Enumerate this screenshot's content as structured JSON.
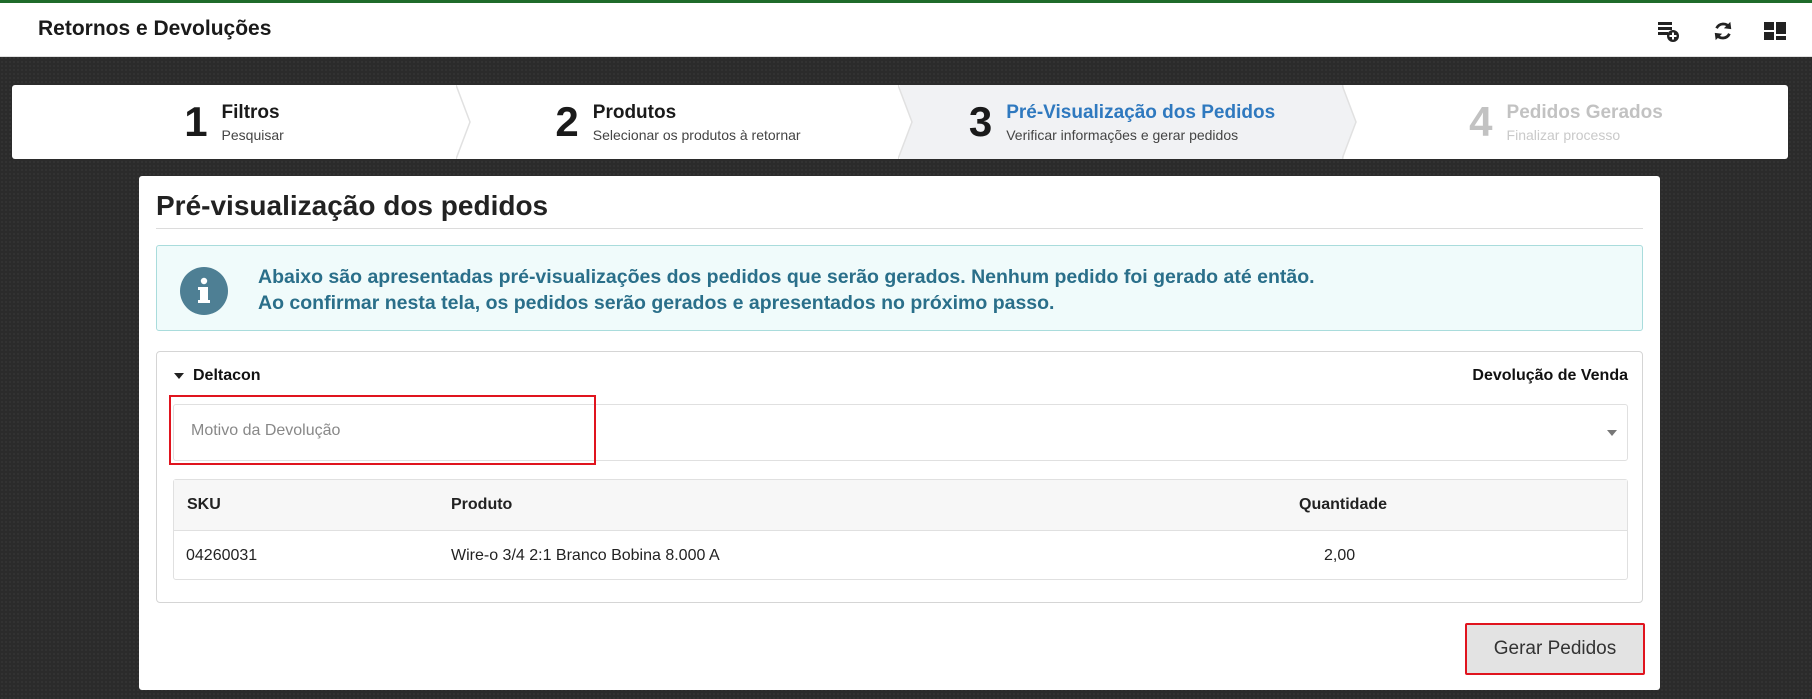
{
  "app": {
    "title": "Retornos e Devoluções"
  },
  "toolbar": {
    "icons": [
      "list-add-icon",
      "refresh-icon",
      "dashboard-icon"
    ]
  },
  "wizard": {
    "steps": [
      {
        "num": "1",
        "title": "Filtros",
        "sub": "Pesquisar",
        "state": "done"
      },
      {
        "num": "2",
        "title": "Produtos",
        "sub": "Selecionar os produtos à retornar",
        "state": "done"
      },
      {
        "num": "3",
        "title": "Pré-Visualização dos Pedidos",
        "sub": "Verificar informações e gerar pedidos",
        "state": "active"
      },
      {
        "num": "4",
        "title": "Pedidos Gerados",
        "sub": "Finalizar processo",
        "state": "disabled"
      }
    ]
  },
  "panel": {
    "title": "Pré-visualização dos pedidos",
    "info_line1": "Abaixo são apresentadas pré-visualizações dos pedidos que serão gerados. Nenhum pedido foi gerado até então.",
    "info_line2": "Ao confirmar nesta tela, os pedidos serão gerados e apresentados no próximo passo.",
    "group": {
      "name": "Deltacon",
      "type": "Devolução de Venda",
      "select_placeholder": "Motivo da Devolução",
      "columns": {
        "sku": "SKU",
        "produto": "Produto",
        "quantidade": "Quantidade"
      },
      "rows": [
        {
          "sku": "04260031",
          "produto": "Wire-o 3/4 2:1 Branco Bobina 8.000 A",
          "quantidade": "2,00"
        }
      ]
    },
    "submit_label": "Gerar Pedidos"
  },
  "colors": {
    "accent": "#2f79bf",
    "info_text": "#2a6f8a",
    "highlight": "#e0141e",
    "topbar_border": "#1f6b2a"
  }
}
